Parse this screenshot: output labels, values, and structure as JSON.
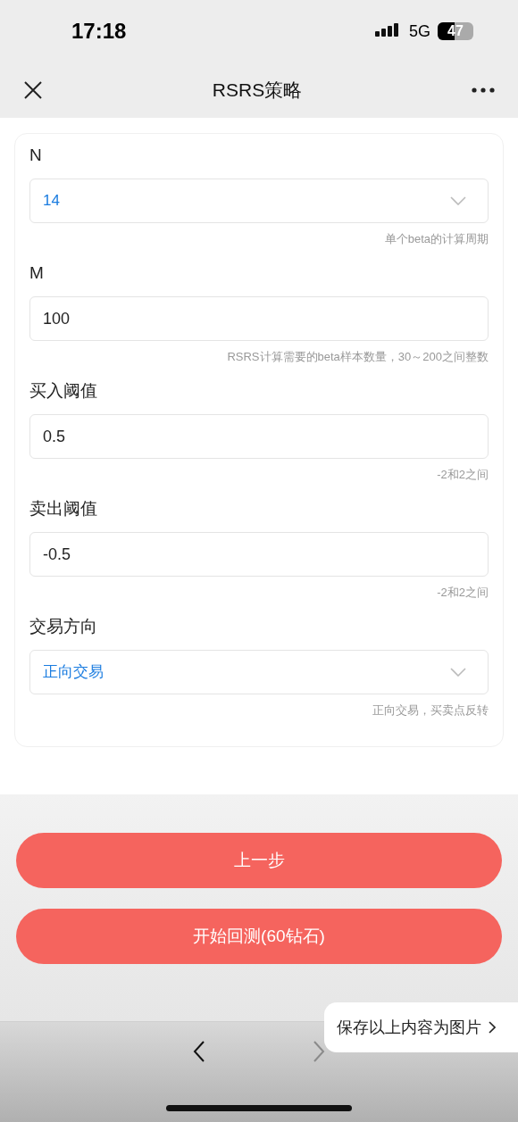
{
  "status_bar": {
    "time": "17:18",
    "network": "5G",
    "battery": "47"
  },
  "nav": {
    "title": "RSRS策略"
  },
  "form": [
    {
      "kind": "select",
      "label": "N",
      "value": "14",
      "hint": "单个beta的计算周期"
    },
    {
      "kind": "input",
      "label": "M",
      "value": "100",
      "hint": "RSRS计算需要的beta样本数量，30～200之间整数"
    },
    {
      "kind": "input",
      "label": "买入阈值",
      "value": "0.5",
      "hint": "-2和2之间"
    },
    {
      "kind": "input",
      "label": "卖出阈值",
      "value": "-0.5",
      "hint": "-2和2之间"
    },
    {
      "kind": "select",
      "label": "交易方向",
      "value": "正向交易",
      "hint": "正向交易，买卖点反转"
    }
  ],
  "buttons": [
    "上一步",
    "开始回测(60钻石)"
  ],
  "toolbar": {
    "back_disabled": false,
    "forward_disabled": true
  },
  "save_popup": {
    "label": "保存以上内容为图片"
  }
}
